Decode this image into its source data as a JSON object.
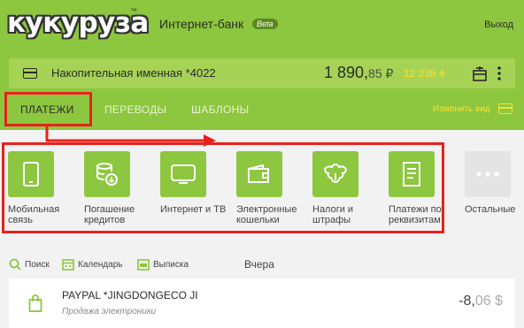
{
  "brand": {
    "logo_text": "кукуруза",
    "tm": "™"
  },
  "header": {
    "title": "Интернет-банк",
    "beta": "Beta",
    "exit": "Выход"
  },
  "account": {
    "name": "Накопительная именная *4022",
    "balance_int": "1 890,",
    "balance_frac": "85 ₽",
    "bonus": "12 238 ǂ"
  },
  "tabs": [
    {
      "label": "ПЛАТЕЖИ",
      "active": true
    },
    {
      "label": "ПЕРЕВОДЫ",
      "active": false
    },
    {
      "label": "ШАБЛОНЫ",
      "active": false
    }
  ],
  "change_view": "Изменить вид",
  "categories": [
    {
      "label": "Мобильная\nсвязь",
      "icon": "phone-icon"
    },
    {
      "label": "Погашение\nкредитов",
      "icon": "coins-icon"
    },
    {
      "label": "Интернет и ТВ",
      "icon": "tv-icon"
    },
    {
      "label": "Электронные\nкошельки",
      "icon": "wallet-icon"
    },
    {
      "label": "Налоги и\nштрафы",
      "icon": "emblem-icon"
    },
    {
      "label": "Платежи по\nреквизитам",
      "icon": "document-icon"
    },
    {
      "label": "Остальные",
      "icon": "more-dots-icon"
    }
  ],
  "toolbar": {
    "search": "Поиск",
    "calendar": "Календарь",
    "statement": "Выписка",
    "day": "Вчера"
  },
  "transactions": [
    {
      "name": "PAYPAL *JINGDONGECO JI",
      "category": "Продажа электроники",
      "amount_int": "-8,",
      "amount_frac": "06 $"
    }
  ],
  "colors": {
    "brand_green": "#8dc63f",
    "accent_yellow": "#f7e233",
    "highlight_red": "#e8211e"
  }
}
